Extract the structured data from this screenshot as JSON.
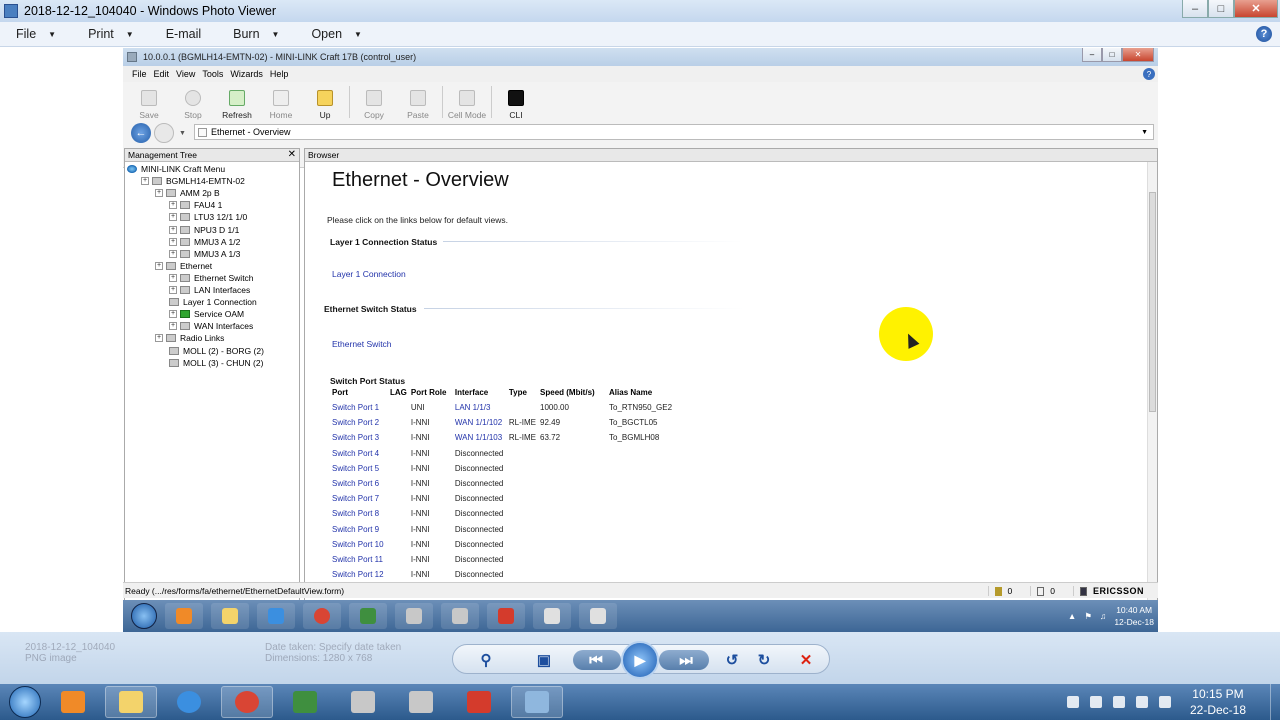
{
  "photo_viewer": {
    "title": "2018-12-12_104040 - Windows Photo Viewer",
    "menu": [
      {
        "label": "File",
        "has_caret": true
      },
      {
        "label": "Print",
        "has_caret": true
      },
      {
        "label": "E-mail",
        "has_caret": false
      },
      {
        "label": "Burn",
        "has_caret": true
      },
      {
        "label": "Open",
        "has_caret": true
      }
    ],
    "help_label": "?",
    "file_info": {
      "name": "2018-12-12_104040",
      "type": "PNG image",
      "color": "Date taken: Specify date taken",
      "dimensions": "Dimensions: 1280 x 768"
    }
  },
  "minilink": {
    "title": "10.0.0.1 (BGMLH14-EMTN-02) - MINI-LINK Craft 17B (control_user)",
    "menu": [
      "File",
      "Edit",
      "View",
      "Tools",
      "Wizards",
      "Help"
    ],
    "toolbar": {
      "save": "Save",
      "stop": "Stop",
      "refresh": "Refresh",
      "home": "Home",
      "up": "Up",
      "copy": "Copy",
      "paste": "Paste",
      "cell_mode": "Cell Mode",
      "cli": "CLI"
    },
    "address": "Ethernet - Overview",
    "tree_title": "Management Tree",
    "tree": [
      {
        "label": "MINI-LINK Craft Menu",
        "icon": "globe-icon"
      },
      {
        "label": "BGMLH14-EMTN-02",
        "icon": "ne-icon"
      },
      {
        "label": "AMM 2p B",
        "icon": "rack-icon"
      },
      {
        "label": "FAU4 1",
        "icon": "board-icon"
      },
      {
        "label": "LTU3 12/1 1/0",
        "icon": "board-icon"
      },
      {
        "label": "NPU3 D 1/1",
        "icon": "board-icon"
      },
      {
        "label": "MMU3 A 1/2",
        "icon": "board-icon"
      },
      {
        "label": "MMU3 A 1/3",
        "icon": "board-icon"
      },
      {
        "label": "Ethernet",
        "icon": "ethernet-icon"
      },
      {
        "label": "Ethernet Switch",
        "icon": "switch-icon"
      },
      {
        "label": "LAN Interfaces",
        "icon": "lan-icon"
      },
      {
        "label": "Layer 1 Connection",
        "icon": "connection-icon"
      },
      {
        "label": "Service OAM",
        "icon": "oam-icon"
      },
      {
        "label": "WAN Interfaces",
        "icon": "wan-icon"
      },
      {
        "label": "Radio Links",
        "icon": "radio-icon"
      },
      {
        "label": "MOLL (2) - BORG (2)",
        "icon": "radio-link-icon"
      },
      {
        "label": "MOLL (3) - CHUN (2)",
        "icon": "radio-link-icon"
      }
    ],
    "browser_title": "Browser",
    "page": {
      "title": "Ethernet - Overview",
      "hint": "Please click on the links below for default views.",
      "section_layer1": "Layer 1 Connection Status",
      "link_layer1": "Layer 1 Connection",
      "section_switch": "Ethernet Switch Status",
      "link_switch": "Ethernet Switch",
      "section_ports": "Switch Port Status"
    },
    "port_table": {
      "headers": [
        "Port",
        "LAG",
        "Port Role",
        "Interface",
        "Type",
        "Speed (Mbit/s)",
        "Alias Name"
      ],
      "rows": [
        [
          "Switch Port 1",
          "",
          "UNI",
          "LAN 1/1/3",
          "",
          "1000.00",
          "To_RTN950_GE2"
        ],
        [
          "Switch Port 2",
          "",
          "I-NNI",
          "WAN 1/1/102",
          "RL-IME",
          "92.49",
          "To_BGCTL05"
        ],
        [
          "Switch Port 3",
          "",
          "I-NNI",
          "WAN 1/1/103",
          "RL-IME",
          "63.72",
          "To_BGMLH08"
        ],
        [
          "Switch Port 4",
          "",
          "I-NNI",
          "Disconnected",
          "",
          "",
          ""
        ],
        [
          "Switch Port 5",
          "",
          "I-NNI",
          "Disconnected",
          "",
          "",
          ""
        ],
        [
          "Switch Port 6",
          "",
          "I-NNI",
          "Disconnected",
          "",
          "",
          ""
        ],
        [
          "Switch Port 7",
          "",
          "I-NNI",
          "Disconnected",
          "",
          "",
          ""
        ],
        [
          "Switch Port 8",
          "",
          "I-NNI",
          "Disconnected",
          "",
          "",
          ""
        ],
        [
          "Switch Port 9",
          "",
          "I-NNI",
          "Disconnected",
          "",
          "",
          ""
        ],
        [
          "Switch Port 10",
          "",
          "I-NNI",
          "Disconnected",
          "",
          "",
          ""
        ],
        [
          "Switch Port 11",
          "",
          "I-NNI",
          "Disconnected",
          "",
          "",
          ""
        ],
        [
          "Switch Port 12",
          "",
          "I-NNI",
          "Disconnected",
          "",
          "",
          ""
        ]
      ]
    },
    "status": {
      "text": "Ready (.../res/forms/fa/ethernet/EthernetDefaultView.form)",
      "alarm_count_1": "0",
      "alarm_count_2": "0",
      "vendor": "ERICSSON"
    },
    "inner_taskbar": {
      "time": "10:40 AM",
      "date": "12-Dec-18"
    }
  },
  "taskbar": {
    "time": "10:15 PM",
    "date": "22-Dec-18"
  },
  "colors": {
    "link": "#2233aa",
    "cursor_highlight": "#fff200",
    "delete": "#dd2211"
  }
}
